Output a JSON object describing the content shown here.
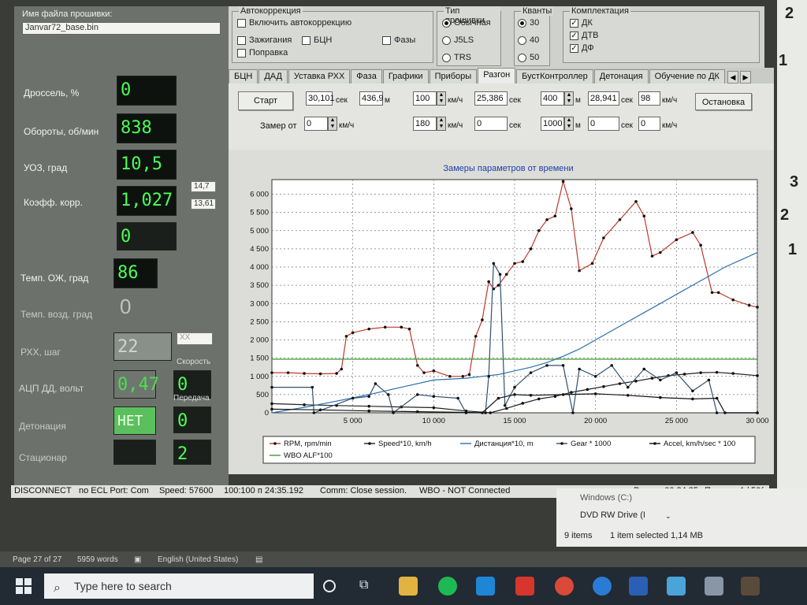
{
  "left": {
    "fw_label": "Имя файла прошивки:",
    "fw_file": "Janvar72_base.bin",
    "throttle_label": "Дроссель, %",
    "throttle_value": "0",
    "rpm_label": "Обороты, об/мин",
    "rpm_value": "838",
    "uoz_label": "УОЗ, град",
    "uoz_value": "10,5",
    "koef_label": "Коэфф. корр.",
    "koef_value": "1,027",
    "koef_aux1": "14,7",
    "koef_aux2": "13,61",
    "blank_value": "0",
    "coolant_label": "Темп. ОЖ, град",
    "coolant_value": "86",
    "air_label": "Темп. возд. град",
    "air_value": "0",
    "rhh_label": "РХХ, шаг",
    "rhh_value": "22",
    "xx_badge": "XX",
    "speed_label": "Скорость",
    "adc_label": "АЦП ДД, вольт",
    "adc_value": "0,47",
    "speed_value": "0",
    "gear_label": "Передача",
    "knock_label": "Детонация",
    "knock_value": "НЕТ",
    "gear_value": "0",
    "stationary_label": "Стационар",
    "stationary_value": "2"
  },
  "autocorr": {
    "title": "Автокоррекция",
    "enable": "Включить автокоррекцию",
    "ignition": "Зажигания",
    "bcn": "БЦН",
    "phases": "Фазы",
    "correction": "Поправка"
  },
  "fwtype": {
    "title": "Тип прошивки",
    "normal": "Обычная",
    "j5ls": "J5LS",
    "trs": "TRS"
  },
  "quant": {
    "title": "Кванты",
    "q30": "30",
    "q40": "40",
    "q50": "50"
  },
  "equip": {
    "title": "Комплектация",
    "dk": "ДК",
    "dtv": "ДТВ",
    "df": "ДФ"
  },
  "tabs": [
    "БЦН",
    "ДАД",
    "Уставка РХХ",
    "Фаза",
    "Графики",
    "Приборы",
    "Разгон",
    "БустКонтроллер",
    "Детонация",
    "Обучение по ДК"
  ],
  "tab_scroll_left": "◀",
  "tab_scroll_right": "▶",
  "razgon": {
    "start": "Старт",
    "stop": "Остановка",
    "t1": "30,101",
    "sec": "сек",
    "d1": "436,9",
    "m": "м",
    "v1": "100",
    "kmh": "км/ч",
    "t2": "25,386",
    "d2": "400",
    "t3": "28,941",
    "v3": "98",
    "measure_from": "Замер от",
    "from_v": "0",
    "v4": "180",
    "t4": "0",
    "d5": "1000",
    "t5": "0",
    "v5": "0",
    "spin_up": "▲",
    "spin_down": "▼"
  },
  "chart_data": {
    "type": "line",
    "title": "Замеры параметров от времени",
    "xlim": [
      0,
      30000
    ],
    "ylim": [
      0,
      6400
    ],
    "xticks": [
      5000,
      10000,
      15000,
      20000,
      25000,
      30000
    ],
    "xtick_labels": [
      "5 000",
      "10 000",
      "15 000",
      "20 000",
      "25 000",
      "30 000"
    ],
    "yticks": [
      0,
      500,
      1000,
      1500,
      2000,
      2500,
      3000,
      3500,
      4000,
      4500,
      5000,
      5500,
      6000
    ],
    "ytick_labels": [
      "0",
      "500",
      "1 000",
      "1 500",
      "2 000",
      "2 500",
      "3 000",
      "3 500",
      "4 000",
      "4 500",
      "5 000",
      "5 500",
      "6 000"
    ],
    "grid": true,
    "legend_position": "bottom",
    "series": [
      {
        "name": "RPM, rpm/min",
        "color": "#c0392b",
        "marker": true,
        "x": [
          0,
          1000,
          2000,
          3000,
          4000,
          4300,
          4600,
          5000,
          6000,
          7000,
          8000,
          8500,
          9000,
          9400,
          10000,
          11000,
          11800,
          12200,
          12600,
          13000,
          13400,
          13700,
          14000,
          14500,
          15000,
          15500,
          16000,
          16500,
          17000,
          17500,
          18000,
          18500,
          19000,
          19800,
          20500,
          21500,
          22500,
          23000,
          23500,
          24000,
          25000,
          26000,
          26500,
          27200,
          27600,
          28500,
          29500,
          30000
        ],
        "y": [
          1100,
          1100,
          1080,
          1070,
          1080,
          1200,
          2100,
          2200,
          2300,
          2350,
          2350,
          2300,
          1300,
          1100,
          1150,
          1000,
          1000,
          1050,
          2100,
          2550,
          3600,
          3400,
          3500,
          3800,
          4100,
          4150,
          4500,
          5000,
          5300,
          5400,
          6350,
          5600,
          3900,
          4100,
          4800,
          5300,
          5800,
          5400,
          4300,
          4400,
          4750,
          4950,
          4600,
          3300,
          3300,
          3100,
          2950,
          2900
        ]
      },
      {
        "name": "Speed*10, km/h",
        "color": "#222222",
        "marker": true,
        "x": [
          0,
          2000,
          4000,
          6000,
          8000,
          10000,
          12000,
          13500,
          14500,
          15500,
          16500,
          17500,
          18500,
          19500,
          20500,
          21500,
          22500,
          23500,
          24500,
          25500,
          26500,
          27500,
          28500,
          30000
        ],
        "y": [
          250,
          220,
          200,
          180,
          160,
          140,
          50,
          0,
          120,
          260,
          380,
          450,
          560,
          640,
          720,
          800,
          870,
          950,
          1020,
          1060,
          1100,
          1110,
          1080,
          1020
        ]
      },
      {
        "name": "Дистанция*10, m",
        "color": "#2c6fb0",
        "marker": false,
        "x": [
          0,
          2000,
          4000,
          6000,
          8000,
          10000,
          12000,
          13000,
          14000,
          15000,
          16000,
          17000,
          18000,
          19000,
          20000,
          21000,
          22000,
          23000,
          24000,
          25000,
          26000,
          27000,
          28000,
          29000,
          30000
        ],
        "y": [
          0,
          150,
          320,
          500,
          700,
          900,
          950,
          1000,
          1050,
          1150,
          1250,
          1380,
          1550,
          1750,
          2000,
          2250,
          2500,
          2750,
          3000,
          3250,
          3500,
          3750,
          4000,
          4200,
          4400
        ]
      },
      {
        "name": "Gear * 1000",
        "color": "#30506e",
        "marker": true,
        "x": [
          0,
          2500,
          2600,
          5000,
          6000,
          6400,
          7200,
          7500,
          9000,
          10000,
          11500,
          12000,
          13200,
          13400,
          13700,
          14100,
          14400,
          15000,
          16000,
          17000,
          18000,
          18600,
          19000,
          20000,
          21000,
          22000,
          23000,
          24000,
          25000,
          26000,
          27000,
          27500,
          30000
        ],
        "y": [
          700,
          700,
          0,
          400,
          450,
          800,
          500,
          0,
          500,
          450,
          400,
          0,
          0,
          1000,
          4100,
          3800,
          200,
          700,
          1100,
          1300,
          1300,
          0,
          1200,
          1000,
          1300,
          700,
          1200,
          900,
          1100,
          600,
          900,
          0,
          0
        ]
      },
      {
        "name": "Accel, km/h/sec * 100",
        "color": "#111111",
        "marker": true,
        "x": [
          0,
          3000,
          6000,
          9000,
          12000,
          13000,
          14000,
          15000,
          16000,
          18000,
          20000,
          22000,
          24000,
          26000,
          27500,
          28000,
          30000
        ],
        "y": [
          100,
          80,
          50,
          30,
          10,
          0,
          400,
          500,
          480,
          500,
          520,
          480,
          420,
          380,
          400,
          0,
          0
        ]
      },
      {
        "name": "WBO ALF*100",
        "color": "#3d9b35",
        "marker": false,
        "x": [
          0,
          30000
        ],
        "y": [
          1470,
          1470
        ]
      }
    ]
  },
  "status": {
    "disconnect": "DISCONNECT",
    "no_ecl": "no ECL Port: Com",
    "speed": "Speed: 57600",
    "ratio": "100:100 п",
    "time1": "24:35.192",
    "comm": "Comm: Close session.",
    "wbo": "WBO - NOT Connected",
    "time_label": "Время: 00.24.35",
    "packets": "Пакеты: 4 / 50("
  },
  "explorer": {
    "windows": "Windows (C:)",
    "dvd": "DVD RW Drive (I",
    "items": "9 items",
    "selected": "1 item selected  1,14 MB"
  },
  "word": {
    "page": "Page 27 of 27",
    "words": "5959 words",
    "lang": "English (United States)"
  },
  "taskbar": {
    "search_placeholder": "Type here to search"
  },
  "right_edge": {
    "n1": "2",
    "n2": "1",
    "n3": "3",
    "n4": "2",
    "n5": "1"
  }
}
